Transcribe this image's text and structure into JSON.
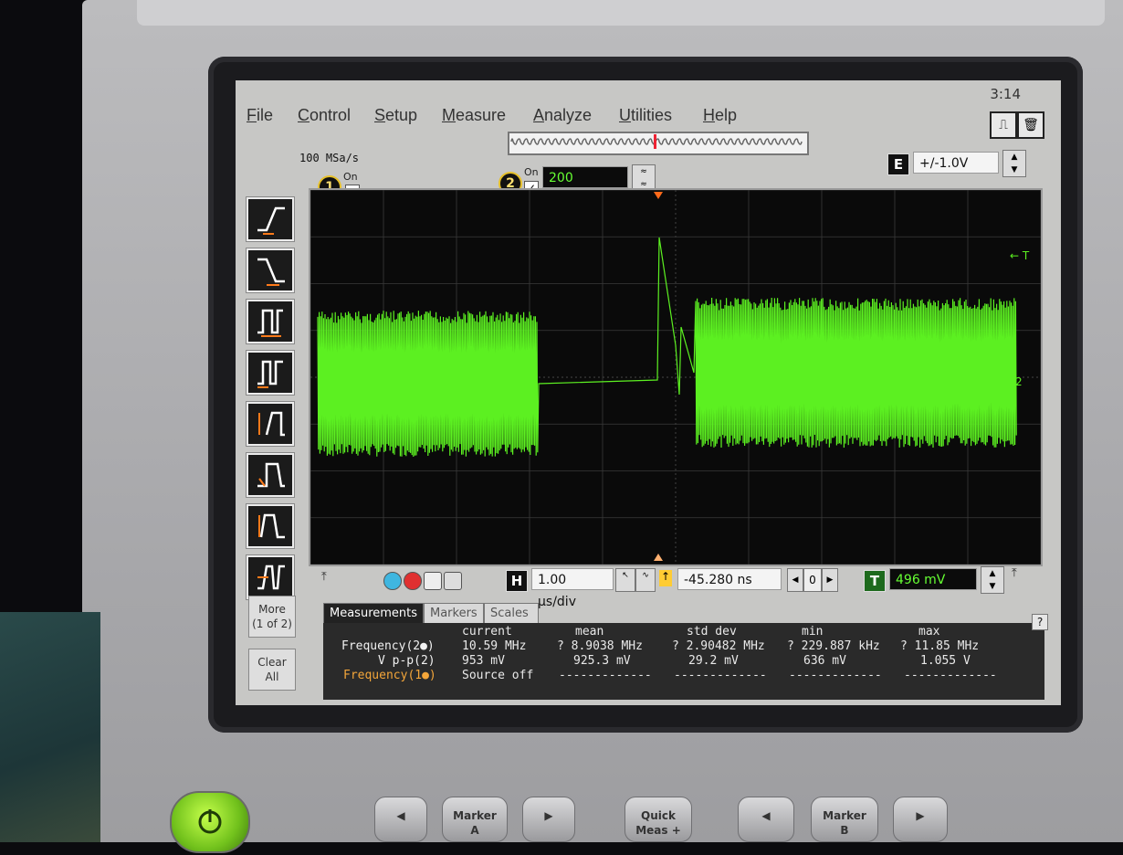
{
  "menu": {
    "items": [
      "File",
      "Control",
      "Setup",
      "Measure",
      "Analyze",
      "Utilities",
      "Help"
    ]
  },
  "status": {
    "clock": "3:14"
  },
  "acquisition": {
    "sample_rate": "100 MSa/s"
  },
  "channels": {
    "ch1": {
      "number": "1",
      "on_label": "On",
      "checked": false
    },
    "ch2": {
      "number": "2",
      "on_label": "On",
      "checked": true,
      "scale": "200 mV/div"
    }
  },
  "external": {
    "label": "E",
    "range": "+/-1.0V"
  },
  "timebase": {
    "label": "H",
    "scale": "1.00 µs/div",
    "delay": "-45.280 ns",
    "step_value": "0"
  },
  "trigger": {
    "label": "T",
    "level": "496 mV",
    "marker_label": "← T"
  },
  "sidebar": {
    "more": "More\n(1 of 2)",
    "clear": "Clear\nAll"
  },
  "tabs": [
    "Measurements",
    "Markers",
    "Scales"
  ],
  "measurements": {
    "headers": [
      "current",
      "mean",
      "std dev",
      "min",
      "max"
    ],
    "rows": [
      {
        "label": "Frequency(2●)",
        "color": "#f1f1f1",
        "values": [
          "10.59 MHz",
          "? 8.9038 MHz",
          "? 2.90482 MHz",
          "? 229.887 kHz",
          "? 11.85 MHz"
        ]
      },
      {
        "label": "V p-p(2)",
        "color": "#f1f1f1",
        "values": [
          "953 mV",
          "925.3 mV",
          "29.2 mV",
          "636 mV",
          "1.055 V"
        ]
      },
      {
        "label": "Frequency(1●)",
        "color": "#f4a63a",
        "values": [
          "Source off",
          "-------------",
          "-------------",
          "-------------",
          "-------------"
        ]
      }
    ]
  },
  "hardware_buttons": {
    "marker_a": "Marker\nA",
    "quick_meas": "Quick\nMeas +",
    "marker_b": "Marker\nB"
  },
  "colors": {
    "trace": "#5cf021",
    "grid": "#3a3a3a",
    "trigger_marker": "#ff6a1a"
  }
}
